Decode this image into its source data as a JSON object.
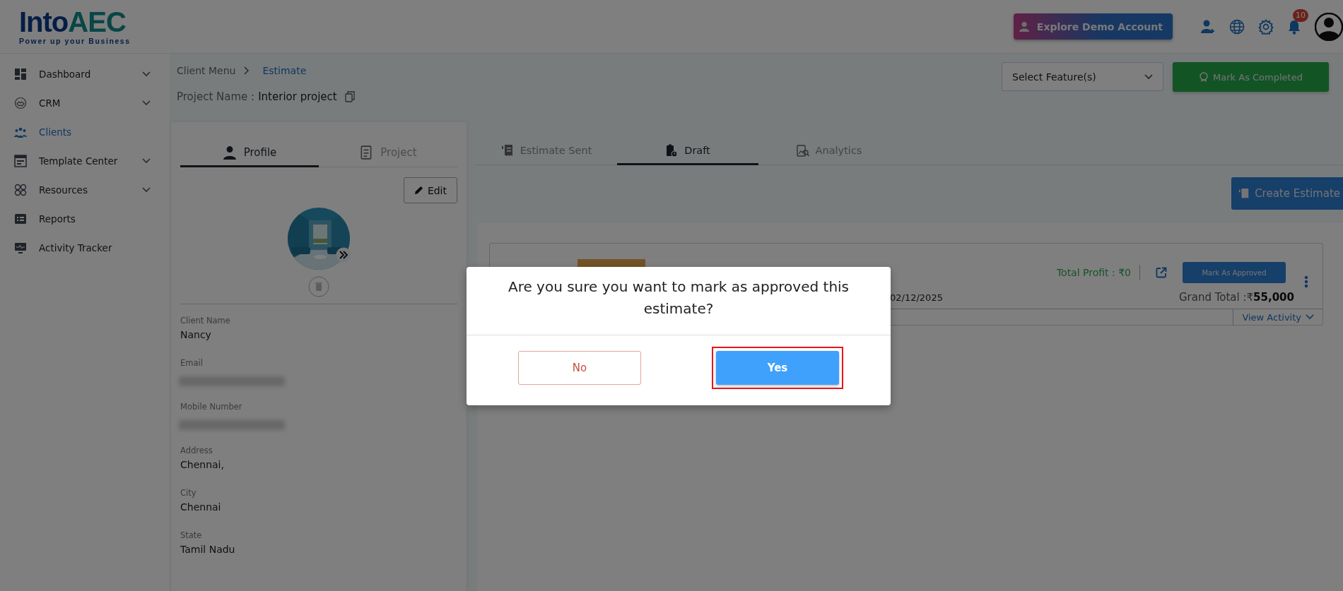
{
  "header": {
    "logo": {
      "main": "Into",
      "accent": "AEC",
      "tagline": "Power up your Business"
    },
    "demo_button": "Explore Demo Account",
    "notification_count": "10"
  },
  "sidebar": {
    "items": [
      {
        "label": "Dashboard",
        "expandable": true,
        "selected": false
      },
      {
        "label": "CRM",
        "expandable": true,
        "selected": false
      },
      {
        "label": "Clients",
        "expandable": false,
        "selected": true
      },
      {
        "label": "Template Center",
        "expandable": true,
        "selected": false
      },
      {
        "label": "Resources",
        "expandable": true,
        "selected": false
      },
      {
        "label": "Reports",
        "expandable": false,
        "selected": false
      },
      {
        "label": "Activity Tracker",
        "expandable": false,
        "selected": false
      }
    ]
  },
  "breadcrumb": [
    {
      "label": "Client Menu",
      "selected": false
    },
    {
      "label": "Estimate",
      "selected": true
    }
  ],
  "project_name": {
    "label": "Project Name :",
    "value": "Interior project"
  },
  "feature_select": {
    "placeholder": "Select Feature(s)"
  },
  "complete_button": "Mark As Completed",
  "profile_card": {
    "tabs": [
      {
        "label": "Profile",
        "selected": true
      },
      {
        "label": "Project",
        "selected": false
      }
    ],
    "edit_button": "Edit",
    "fields": [
      {
        "label": "Client Name",
        "value": "Nancy",
        "redacted": false
      },
      {
        "label": "Email",
        "redacted": true
      },
      {
        "label": "Mobile Number",
        "redacted": true
      },
      {
        "label": "Address",
        "value": "Chennai,",
        "redacted": false
      },
      {
        "label": "City",
        "value": "Chennai",
        "redacted": false
      },
      {
        "label": "State",
        "value": "Tamil Nadu",
        "redacted": false
      }
    ]
  },
  "estimate_tabs": [
    {
      "label": "Estimate Sent",
      "selected": false
    },
    {
      "label": "Draft",
      "selected": true
    },
    {
      "label": "Analytics",
      "selected": false
    }
  ],
  "create_button": "Create Estimate",
  "estimate": {
    "total_profit": "Total Profit : ₹0",
    "approve_button": "Mark As Approved",
    "date": "02/12/2025",
    "grand_total": "Grand Total :₹**55,000**",
    "view_activity": "View Activity"
  },
  "dialog": {
    "message": "Are you sure you want to mark as approved this estimate?",
    "buttons": [
      {
        "label": "No",
        "kind": "cancel",
        "highlighted": false
      },
      {
        "label": "Yes",
        "kind": "confirm",
        "highlighted": true
      }
    ]
  }
}
